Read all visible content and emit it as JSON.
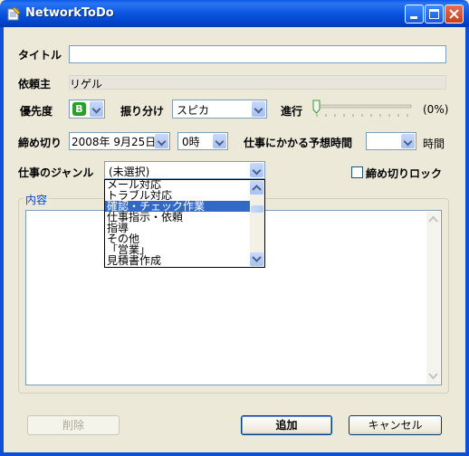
{
  "window": {
    "title": "NetworkToDo",
    "minimize_icon": "minimize-icon",
    "maximize_icon": "maximize-icon",
    "close_icon": "close-icon"
  },
  "form": {
    "title_label": "タイトル",
    "title_value": "",
    "requester_label": "依頼主",
    "requester_value": "リゲル",
    "priority_label": "優先度",
    "priority_value": "B",
    "assign_label": "振り分け",
    "assign_value": "スピカ",
    "progress_label": "進行",
    "progress_value": 0,
    "progress_text": "(0%)",
    "deadline_label": "締め切り",
    "deadline_date": "2008年  9月25日",
    "deadline_hour": "0時",
    "estimate_label": "仕事にかかる予想時間",
    "estimate_value": "",
    "estimate_unit": "時間",
    "genre_label": "仕事のジャンル",
    "genre_value": "(未選択)",
    "genre_options": [
      "メール対応",
      "トラブル対応",
      "確認・チェック作業",
      "仕事指示・依頼",
      "指導",
      "その他",
      "「営業」",
      "見積書作成"
    ],
    "genre_highlighted_index": 2,
    "lock_label": "締め切りロック",
    "lock_checked": false,
    "content_label": "内容",
    "content_value": ""
  },
  "buttons": {
    "delete": "削除",
    "add": "追加",
    "cancel": "キャンセル"
  },
  "colors": {
    "titlebar": "#0a58e8",
    "accent_selected": "#316ac5",
    "priority_badge": "#2a9d2a",
    "window_bg": "#ece9d8"
  }
}
